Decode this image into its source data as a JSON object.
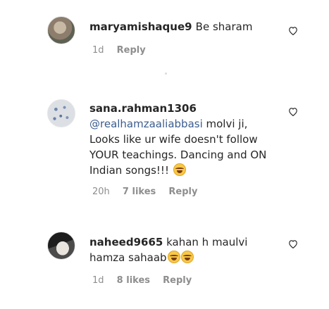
{
  "comments": [
    {
      "username": "maryamishaque9",
      "text": "Be sharam",
      "time": "1d",
      "likes": "",
      "reply_label": "Reply"
    },
    {
      "username": "sana.rahman1306",
      "mention": "@realhamzaaliabbasi",
      "text_line1": " molvi ji,",
      "text_line2": "Looks like ur wife doesn't follow",
      "text_line3": "YOUR teachings. Dancing and ON",
      "text_line4": "Indian songs!!!",
      "time": "20h",
      "likes": "7 likes",
      "reply_label": "Reply"
    },
    {
      "username": "naheed9665",
      "text_line1": " kahan h maulvi",
      "text_line2": "hamza sahaab",
      "time": "1d",
      "likes": "8 likes",
      "reply_label": "Reply"
    }
  ],
  "icons": {
    "like": "heart-outline-icon",
    "emoji": "laughing-tears-emoji"
  }
}
